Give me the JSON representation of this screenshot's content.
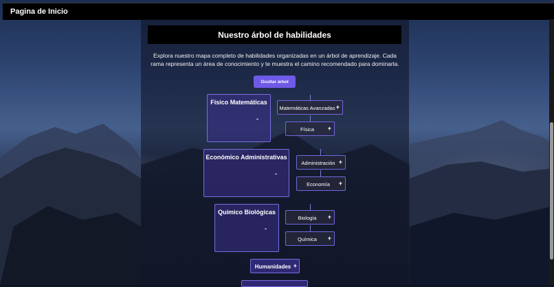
{
  "header": {
    "title": "Pagina de Inicio"
  },
  "main": {
    "heading": "Nuestro árbol de habilidades",
    "intro": "Explora nuestro mapa completo de habilidades organizadas en un árbol de aprendizaje. Cada rama representa un área de conocimiento y te muestra el camino recomendado para dominarla.",
    "toggle_label": "Ocultar árbol"
  },
  "tree": {
    "areas": [
      {
        "name": "Físico Matemáticas",
        "toggle": "-",
        "skills": [
          {
            "label": "Matemáticas Avanzadas",
            "plus": "+"
          },
          {
            "label": "Física",
            "plus": "+"
          }
        ]
      },
      {
        "name": "Económico Administrativas",
        "toggle": "-",
        "skills": [
          {
            "label": "Administración",
            "plus": "+"
          },
          {
            "label": "Economía",
            "plus": "+"
          }
        ]
      },
      {
        "name": "Químico Biológicas",
        "toggle": "-",
        "skills": [
          {
            "label": "Biología",
            "plus": "+"
          },
          {
            "label": "Química",
            "plus": "+"
          }
        ]
      },
      {
        "name": "Humanidades",
        "toggle": "+"
      }
    ]
  },
  "colors": {
    "accent": "#6e5ae6",
    "card_border": "#7a6ee0",
    "topbar": "#000000"
  }
}
